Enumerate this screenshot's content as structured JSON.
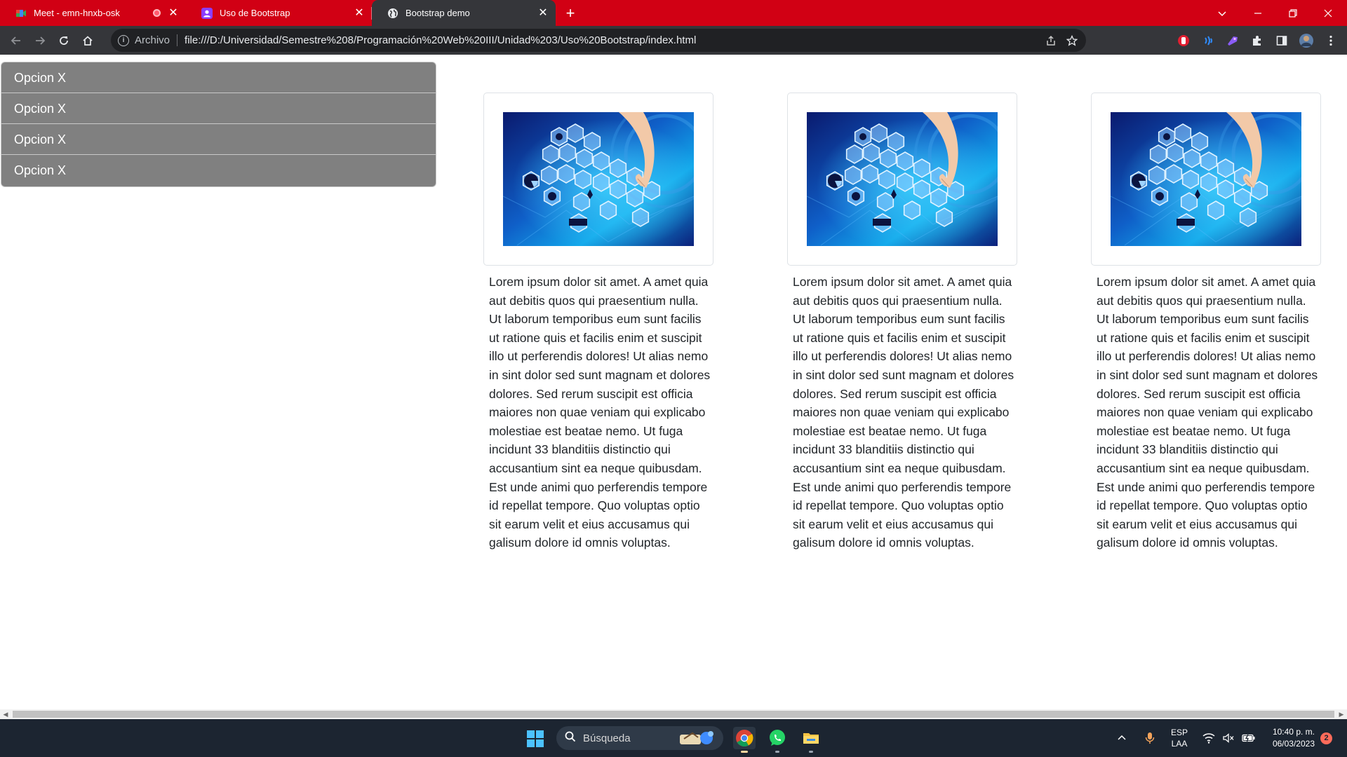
{
  "browser": {
    "tabs": [
      {
        "title": "Meet - emn-hnxb-osk",
        "active": false,
        "recording": true
      },
      {
        "title": "Uso de Bootstrap",
        "active": false,
        "recording": false
      },
      {
        "title": "Bootstrap demo",
        "active": true,
        "recording": false
      }
    ],
    "close_glyph": "✕",
    "new_tab_glyph": "+",
    "address": {
      "scheme_label": "Archivo",
      "url": "file:///D:/Universidad/Semestre%208/Programación%20Web%20III/Unidad%203/Uso%20Bootstrap/index.html"
    },
    "accent_color": "#d10014"
  },
  "page": {
    "menu_items": [
      "Opcion X",
      "Opcion X",
      "Opcion X",
      "Opcion X"
    ],
    "cards": [
      {
        "image": "technology-hexagon-icons-hand-image",
        "text": "Lorem ipsum dolor sit amet. A amet quia aut debitis quos qui praesentium nulla. Ut laborum temporibus eum sunt facilis ut ratione quis et facilis enim et suscipit illo ut perferendis dolores! Ut alias nemo in sint dolor sed sunt magnam et dolores dolores. Sed rerum suscipit est officia maiores non quae veniam qui explicabo molestiae est beatae nemo. Ut fuga incidunt 33 blanditiis distinctio qui accusantium sint ea neque quibusdam. Est unde animi quo perferendis tempore id repellat tempore. Quo voluptas optio sit earum velit et eius accusamus qui galisum dolore id omnis voluptas."
      },
      {
        "image": "technology-hexagon-icons-hand-image",
        "text": "Lorem ipsum dolor sit amet. A amet quia aut debitis quos qui praesentium nulla. Ut laborum temporibus eum sunt facilis ut ratione quis et facilis enim et suscipit illo ut perferendis dolores! Ut alias nemo in sint dolor sed sunt magnam et dolores dolores. Sed rerum suscipit est officia maiores non quae veniam qui explicabo molestiae est beatae nemo. Ut fuga incidunt 33 blanditiis distinctio qui accusantium sint ea neque quibusdam. Est unde animi quo perferendis tempore id repellat tempore. Quo voluptas optio sit earum velit et eius accusamus qui galisum dolore id omnis voluptas."
      },
      {
        "image": "technology-hexagon-icons-hand-image",
        "text": "Lorem ipsum dolor sit amet. A amet quia aut debitis quos qui praesentium nulla. Ut laborum temporibus eum sunt facilis ut ratione quis et facilis enim et suscipit illo ut perferendis dolores! Ut alias nemo in sint dolor sed sunt magnam et dolores dolores. Sed rerum suscipit est officia maiores non quae veniam qui explicabo molestiae est beatae nemo. Ut fuga incidunt 33 blanditiis distinctio qui accusantium sint ea neque quibusdam. Est unde animi quo perferendis tempore id repellat tempore. Quo voluptas optio sit earum velit et eius accusamus qui galisum dolore id omnis voluptas."
      }
    ],
    "menu_color": "#808080"
  },
  "taskbar": {
    "search_placeholder": "Búsqueda",
    "language": {
      "line1": "ESP",
      "line2": "LAA"
    },
    "clock": {
      "time": "10:40 p. m.",
      "date": "06/03/2023"
    },
    "notification_count": "2"
  }
}
